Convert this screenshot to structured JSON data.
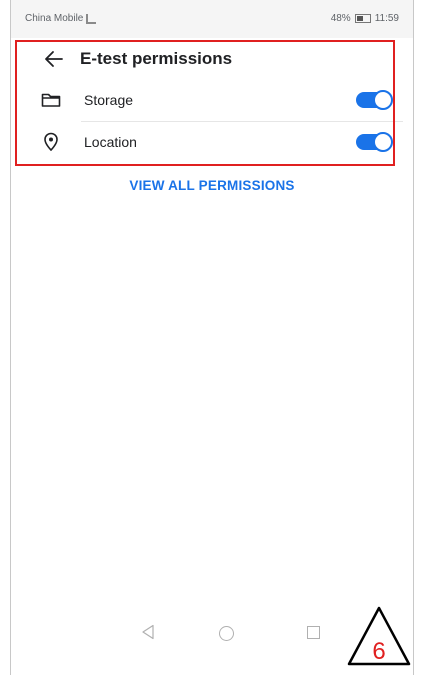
{
  "statusbar": {
    "carrier": "China Mobile",
    "right_info": "48%",
    "time": "11:59"
  },
  "appbar": {
    "title": "E-test permissions"
  },
  "permissions": [
    {
      "label": "Storage",
      "icon": "folder-icon",
      "enabled": true
    },
    {
      "label": "Location",
      "icon": "location-pin-icon",
      "enabled": true
    }
  ],
  "view_all_label": "VIEW ALL PERMISSIONS",
  "annotation": {
    "step_number": "6",
    "highlight_color": "#e02020"
  },
  "colors": {
    "accent": "#1a73e8"
  }
}
